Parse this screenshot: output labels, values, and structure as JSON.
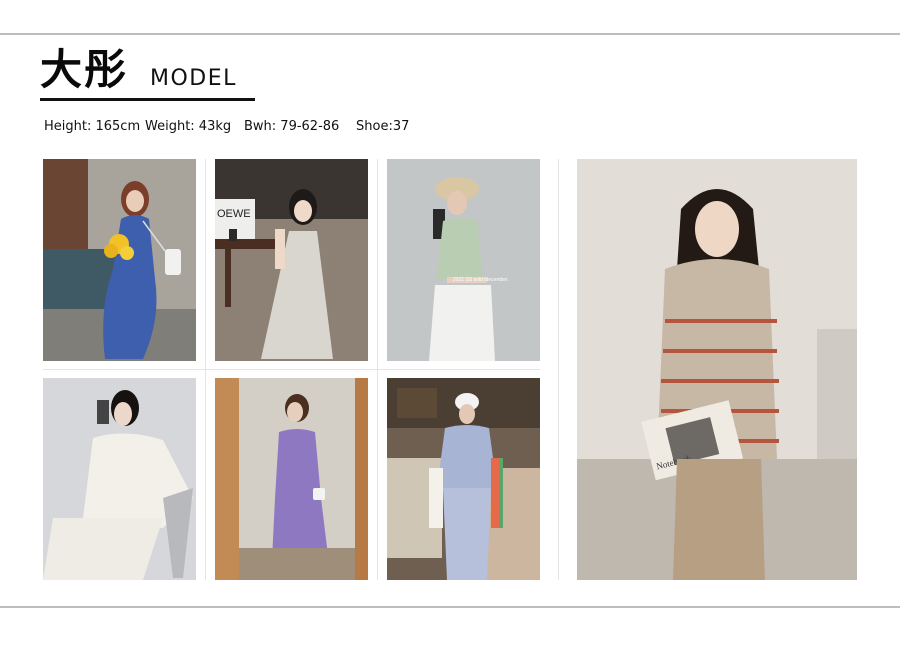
{
  "header": {
    "title_cn": "大彤",
    "title_en": "MODEL"
  },
  "stats": {
    "height": "Height: 165cm",
    "weight": "Weight: 43kg",
    "bwh": "Bwh: 79-62-86",
    "shoe": "Shoe:37"
  },
  "photos": {
    "p2_sign": "OEWE",
    "p3_caption": "2021 SS sold /december.",
    "p7_book": "Notebook"
  }
}
